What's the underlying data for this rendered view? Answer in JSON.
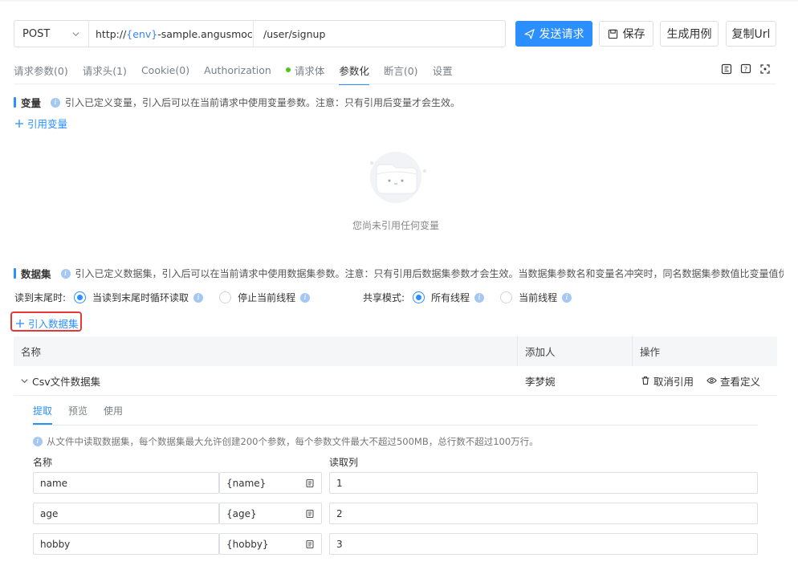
{
  "request": {
    "method": "POST",
    "host_prefix": "http://",
    "host_env": "{env}",
    "host_suffix": "-sample.angusmock.clou",
    "path": "/user/signup"
  },
  "buttons": {
    "send": "发送请求",
    "save": "保存",
    "gen_case": "生成用例",
    "copy_url": "复制Url"
  },
  "tabs": [
    "请求参数(0)",
    "请求头(1)",
    "Cookie(0)",
    "Authorization",
    "请求体",
    "参数化",
    "断言(0)",
    "设置"
  ],
  "variables": {
    "title": "变量",
    "hint": "引入已定义变量，引入后可以在当前请求中使用变量参数。注意：只有引用后变量才会生效。",
    "add_link": "引用变量",
    "empty_text": "您尚未引用任何变量"
  },
  "datasets": {
    "title": "数据集",
    "hint": "引入已定义数据集，引入后可以在当前请求中使用数据集参数。注意：只有引用后数据集参数才会生效。当数据集参数名和变量名冲突时，同名数据集参数值比变量值优先",
    "read_end_label": "读到末尾时:",
    "read_end_options": [
      "当读到末尾时循环读取",
      "停止当前线程"
    ],
    "share_label": "共享模式:",
    "share_options": [
      "所有线程",
      "当前线程"
    ],
    "add_link": "引入数据集",
    "table_headers": [
      "名称",
      "添加人",
      "操作"
    ],
    "rows": [
      {
        "name": "Csv文件数据集",
        "owner": "李梦婉",
        "action_cancel": "取消引用",
        "action_view": "查看定义"
      }
    ],
    "subtabs": [
      "提取",
      "预览",
      "使用"
    ],
    "note": "从文件中读取数据集，每个数据集最大允许创建200个参数，每个参数文件最大不超过500MB，总行数不超过100万行。",
    "param_headers": [
      "名称",
      "读取列"
    ],
    "params": [
      {
        "name": "name",
        "ref": "{name}",
        "column": "1"
      },
      {
        "name": "age",
        "ref": "{age}",
        "column": "2"
      },
      {
        "name": "hobby",
        "ref": "{hobby}",
        "column": "3"
      }
    ]
  },
  "colors": {
    "primary": "#2b8fff",
    "highlight": "#e53935",
    "active_dot": "#52c41a"
  }
}
